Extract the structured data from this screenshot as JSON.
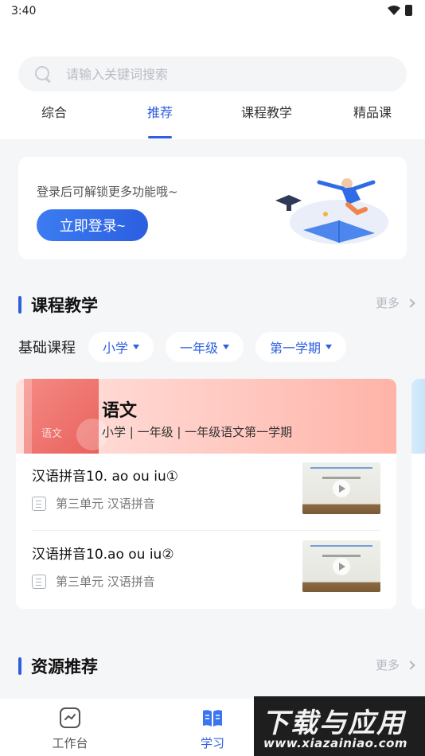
{
  "status_bar": {
    "time": "3:40"
  },
  "search": {
    "placeholder": "请输入关键词搜索"
  },
  "tabs": [
    {
      "label": "综合"
    },
    {
      "label": "推荐"
    },
    {
      "label": "课程教学"
    },
    {
      "label": "精品课"
    }
  ],
  "active_tab": "推荐",
  "login_card": {
    "tip": "登录后可解锁更多功能哦~",
    "button_label": "立即登录~"
  },
  "course_section": {
    "title": "课程教学",
    "more_label": "更多",
    "filter_label": "基础课程",
    "filters": [
      {
        "label": "小学"
      },
      {
        "label": "一年级"
      },
      {
        "label": "第一学期"
      }
    ],
    "course": {
      "subject": "语文",
      "meta": "小学 | 一年级 | 一年级语文第一学期",
      "cover_text": "语文",
      "lessons": [
        {
          "title": "汉语拼音10. ao ou iu①",
          "unit": "第三单元 汉语拼音"
        },
        {
          "title": "汉语拼音10.ao ou iu②",
          "unit": "第三单元 汉语拼音"
        }
      ]
    }
  },
  "resource_section": {
    "title": "资源推荐",
    "more_label": "更多"
  },
  "bottom_nav": [
    {
      "label": "工作台",
      "icon": "workbench-icon"
    },
    {
      "label": "学习",
      "icon": "book-icon"
    }
  ],
  "watermark": {
    "line1": "下载与应用",
    "line2": "www.xiazainiao.com"
  },
  "colors": {
    "accent": "#2f5fe0",
    "background": "#f5f6f8"
  }
}
